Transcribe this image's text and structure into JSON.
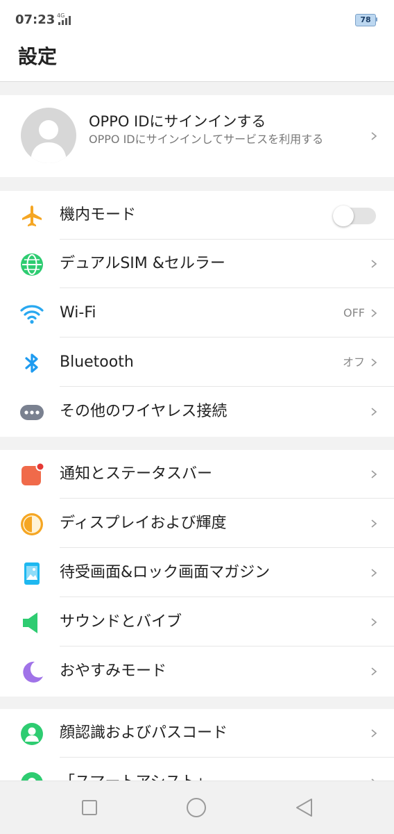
{
  "status_bar": {
    "time": "07:23",
    "network": "4G",
    "battery": "78"
  },
  "page": {
    "title": "設定"
  },
  "account": {
    "title": "OPPO IDにサインインする",
    "subtitle": "OPPO IDにサインインしてサービスを利用する"
  },
  "connectivity": {
    "airplane": {
      "label": "機内モード",
      "toggle_on": false,
      "icon": "airplane-icon",
      "color": "#F5A623"
    },
    "dual_sim": {
      "label": "デュアルSIM &セルラー",
      "icon": "globe-icon",
      "color": "#2ECC71"
    },
    "wifi": {
      "label": "Wi-Fi",
      "value": "OFF",
      "icon": "wifi-icon",
      "color": "#29A8F0"
    },
    "bluetooth": {
      "label": "Bluetooth",
      "value": "オフ",
      "icon": "bluetooth-icon",
      "color": "#1E9BF0"
    },
    "other_wireless": {
      "label": "その他のワイヤレス接続",
      "icon": "more-dots-icon",
      "color": "#7A8190"
    }
  },
  "personalization": {
    "notifications": {
      "label": "通知とステータスバー",
      "icon": "notification-icon",
      "color": "#F06A4A"
    },
    "display": {
      "label": "ディスプレイおよび輝度",
      "icon": "brightness-icon",
      "color": "#F5A623"
    },
    "wallpaper": {
      "label": "待受画面&ロック画面マガジン",
      "icon": "wallpaper-icon",
      "color": "#1EB8F0"
    },
    "sound": {
      "label": "サウンドとバイブ",
      "icon": "speaker-icon",
      "color": "#2ECC71"
    },
    "dnd": {
      "label": "おやすみモード",
      "icon": "moon-icon",
      "color": "#A073E8"
    }
  },
  "security": {
    "face": {
      "label": "顔認識およびパスコード",
      "icon": "face-id-icon",
      "color": "#2ECC71"
    },
    "smart": {
      "label": "「スマートアシスト」",
      "icon": "smart-assist-icon",
      "color": "#2ECC71"
    }
  },
  "nav": {
    "recent": "recent-apps-icon",
    "home": "home-icon",
    "back": "back-icon"
  }
}
